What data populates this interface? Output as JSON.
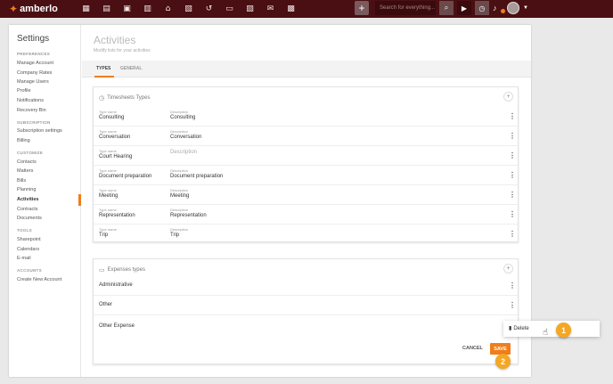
{
  "app": {
    "logo_text": "amberlo"
  },
  "topbar": {
    "nav_icons": [
      "dashboard-icon",
      "contacts-icon",
      "matters-icon",
      "documents-icon",
      "bank-icon",
      "calendar-icon",
      "history-icon",
      "folder-icon",
      "notes-icon",
      "mail-icon",
      "reports-icon"
    ],
    "search_placeholder": "Search for everything..."
  },
  "sidebar": {
    "title": "Settings",
    "sections": [
      {
        "label": "PREFERENCES",
        "items": [
          "Manage Account",
          "Company Rates",
          "Manage Users",
          "Profile",
          "Notifications",
          "Recovery Bin"
        ]
      },
      {
        "label": "SUBSCRIPTION",
        "items": [
          "Subscription settings",
          "Billing"
        ]
      },
      {
        "label": "CUSTOMIZE",
        "items": [
          "Contacts",
          "Matters",
          "Bills",
          "Planning",
          "Activities",
          "Contracts",
          "Documents"
        ]
      },
      {
        "label": "TOOLS",
        "items": [
          "Sharepoint",
          "Calendars",
          "E-mail"
        ]
      },
      {
        "label": "ACCOUNTS",
        "items": [
          "Create New Account"
        ]
      }
    ],
    "active_item": "Activities"
  },
  "page": {
    "title": "Activities",
    "subtitle": "Modify lists for your activities",
    "tabs": [
      "TYPES",
      "GENERAL"
    ]
  },
  "timesheets": {
    "title": "Timesheets Types",
    "name_label": "Type name",
    "desc_label": "Description",
    "rows": [
      {
        "name": "Consulting",
        "desc": "Consulting"
      },
      {
        "name": "Conversation",
        "desc": "Conversation"
      },
      {
        "name": "Court Hearing",
        "desc": "Description"
      },
      {
        "name": "Document preparation",
        "desc": "Document preparation"
      },
      {
        "name": "Meeting",
        "desc": "Meeting"
      },
      {
        "name": "Representation",
        "desc": "Representation"
      },
      {
        "name": "Trip",
        "desc": "Trip"
      }
    ]
  },
  "expenses": {
    "title": "Expenses types",
    "rows": [
      "Administrative",
      "Other",
      "Other Expense"
    ]
  },
  "actions": {
    "cancel": "CANCEL",
    "save": "SAVE"
  },
  "context_menu": {
    "delete": "Delete"
  },
  "badges": [
    "1",
    "2"
  ],
  "colors": {
    "topbar": "#4a0f12",
    "accent": "#f07d1a",
    "badge": "#f5a623"
  }
}
